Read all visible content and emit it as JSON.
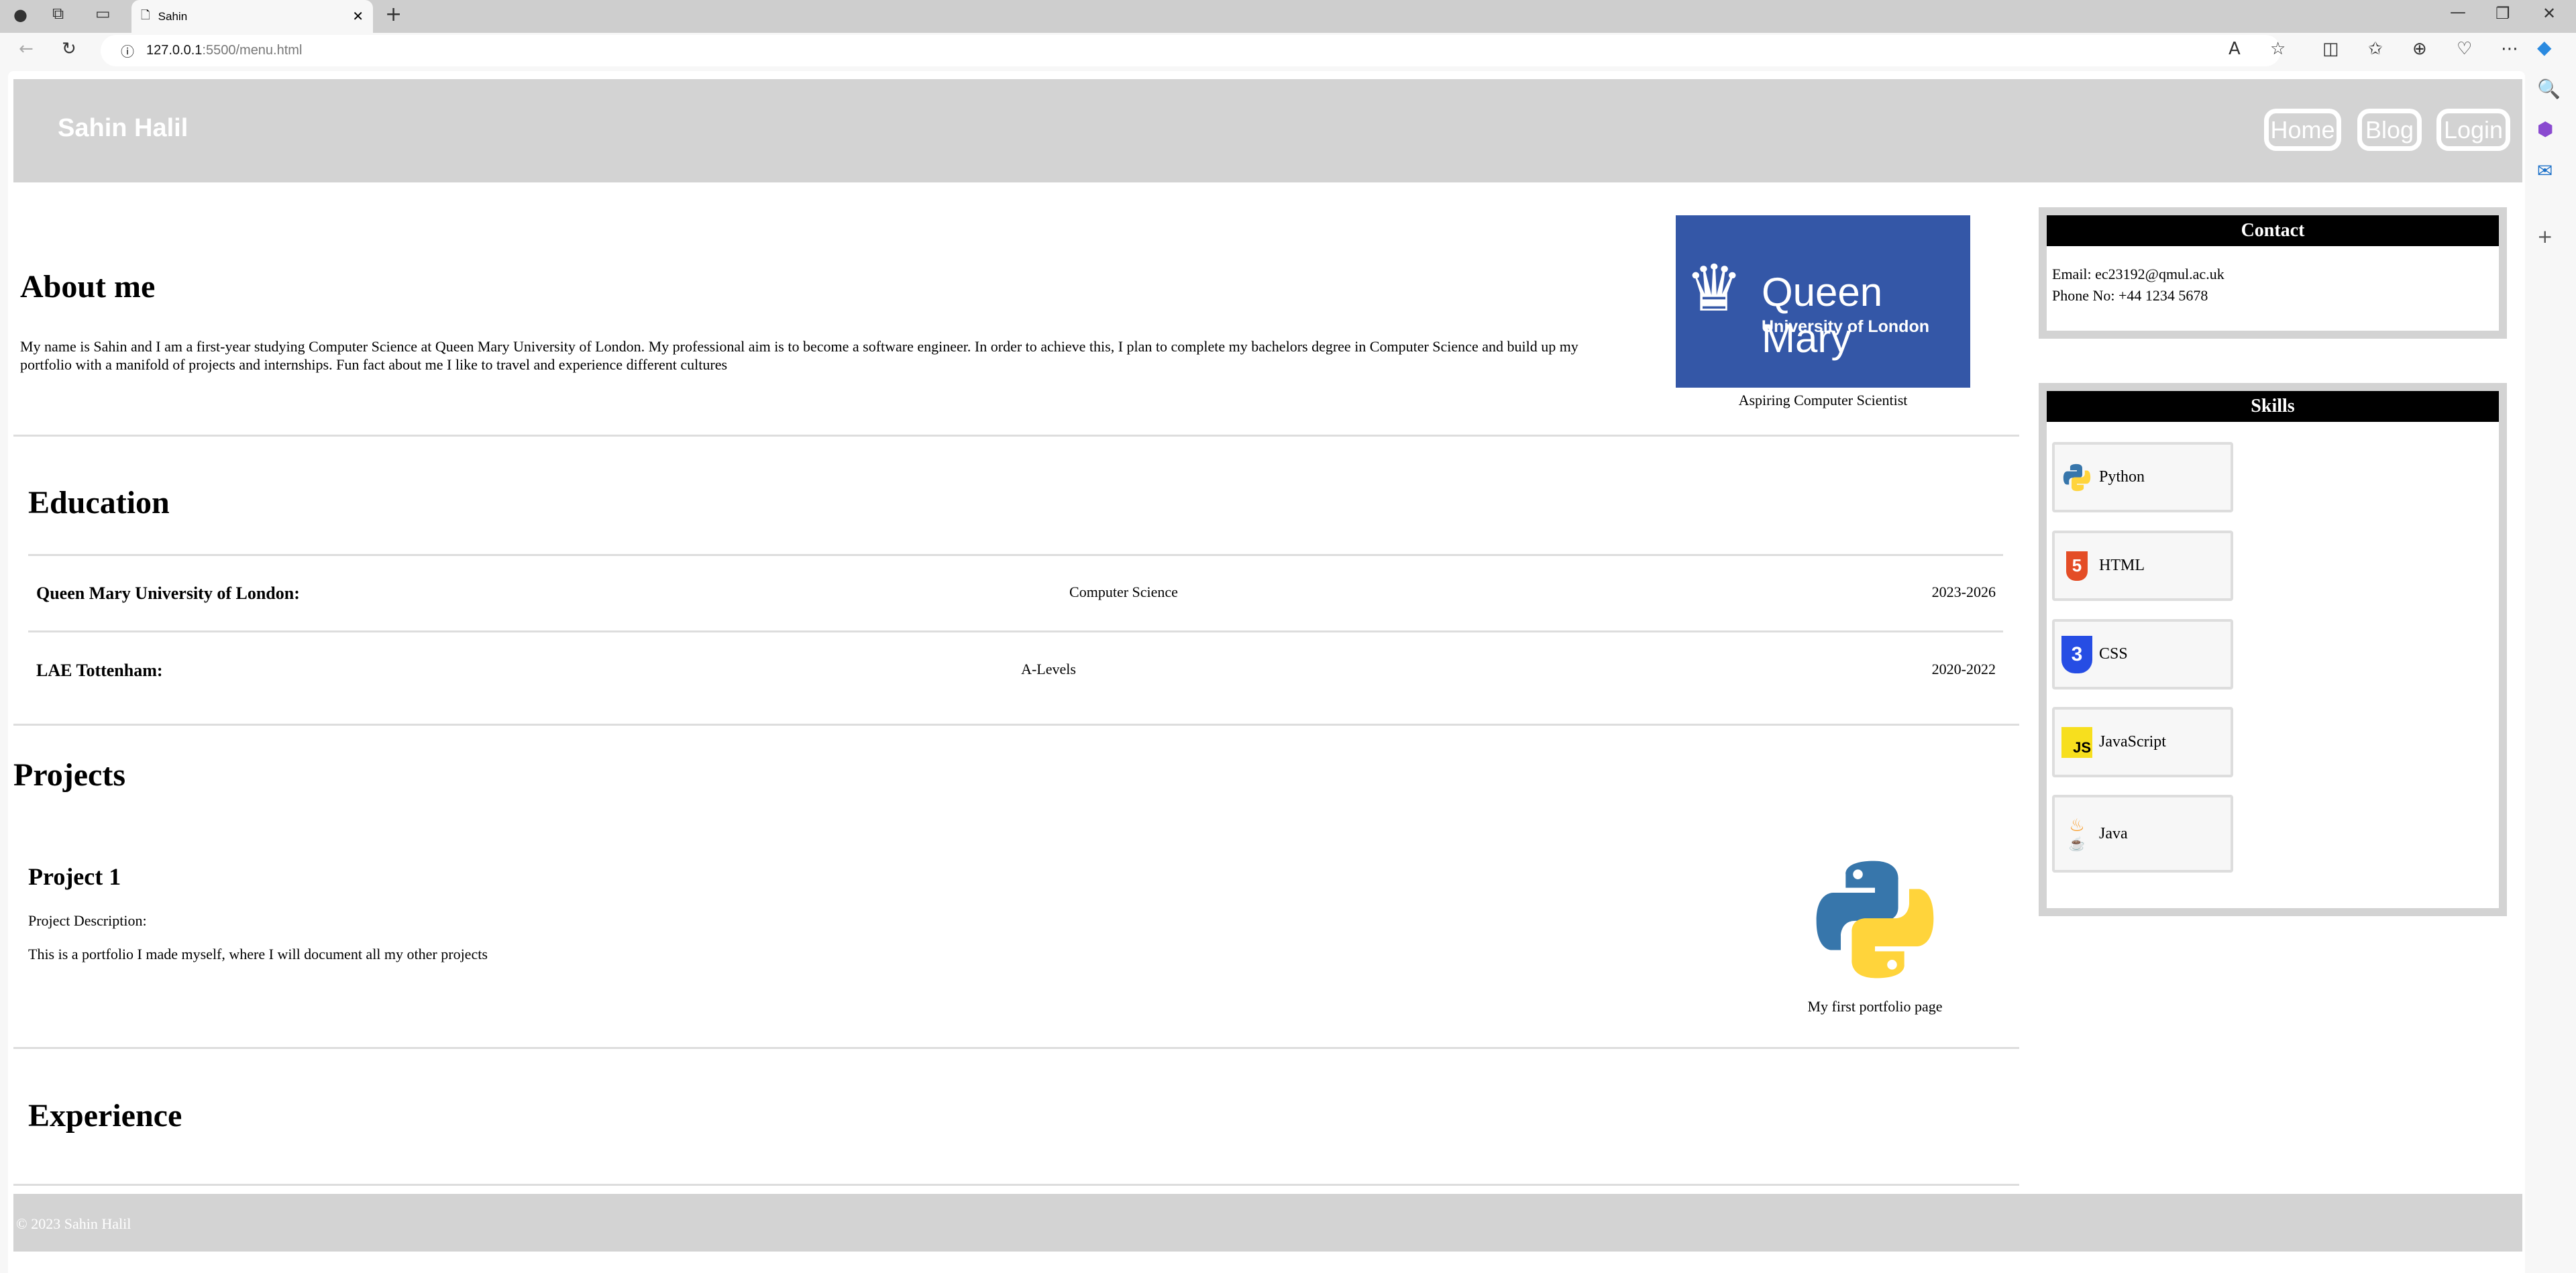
{
  "browser": {
    "tab_title": "Sahin",
    "url_host": "127.0.0.1",
    "url_rest": ":5500/menu.html"
  },
  "header": {
    "brand": "Sahin Halil",
    "nav": [
      "Home",
      "Blog",
      "Login"
    ]
  },
  "about": {
    "title": "About me",
    "text": "My name is Sahin and I am a first-year studying Computer Science at Queen Mary University of London. My professional aim is to become a software engineer. In order to achieve this, I plan to complete my bachelors degree in Computer Science and build up my portfolio with a manifold of projects and internships. Fun fact about me I like to travel and experience different cultures",
    "logo_line1": "Queen Mary",
    "logo_line2": "University of London",
    "caption": "Aspiring Computer Scientist"
  },
  "education": {
    "title": "Education",
    "rows": [
      {
        "school": "Queen Mary University of London:",
        "subject": "Computer Science",
        "years": "2023-2026"
      },
      {
        "school": "LAE Tottenham:",
        "subject": "A-Levels",
        "years": "2020-2022"
      }
    ]
  },
  "projects": {
    "title": "Projects",
    "items": [
      {
        "name": "Project 1",
        "label": "Project Description:",
        "description": "This is a portfolio I made myself, where I will document all my other projects",
        "caption": "My first portfolio page"
      }
    ]
  },
  "experience": {
    "title": "Experience"
  },
  "contact": {
    "title": "Contact",
    "email": "Email: ec23192@qmul.ac.uk",
    "phone": "Phone No: +44 1234 5678"
  },
  "skills": {
    "title": "Skills",
    "items": [
      "Python",
      "HTML",
      "CSS",
      "JavaScript",
      "Java"
    ]
  },
  "footer": {
    "text": "© 2023 Sahin Halil"
  },
  "colors": {
    "header_bg": "#d3d3d3",
    "qm_blue": "#3457a7"
  }
}
